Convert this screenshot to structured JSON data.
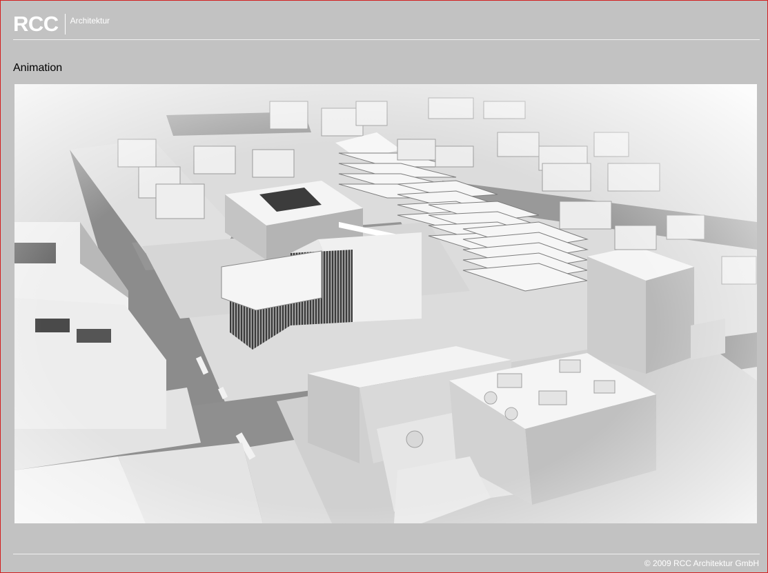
{
  "header": {
    "logo": "RCC",
    "subtitle": "Architektur"
  },
  "main": {
    "title": "Animation",
    "media_icon": "architecture-render-image"
  },
  "footer": {
    "copyright": "© 2009 RCC Architektur GmbH"
  },
  "colors": {
    "background": "#c2c2c2",
    "frame": "#d21e1e",
    "text_light": "#ffffff",
    "text_dark": "#000000"
  }
}
